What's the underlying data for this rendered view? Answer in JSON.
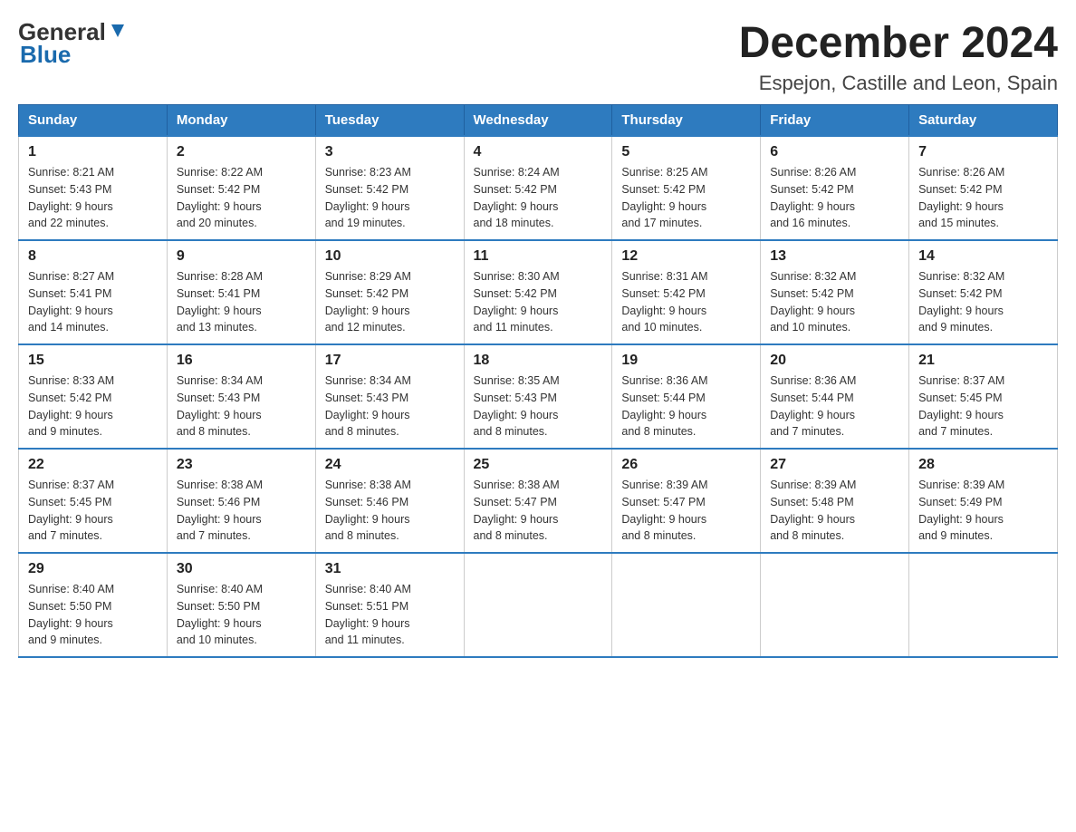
{
  "logo": {
    "general": "General",
    "blue": "Blue"
  },
  "title": "December 2024",
  "subtitle": "Espejon, Castille and Leon, Spain",
  "headers": [
    "Sunday",
    "Monday",
    "Tuesday",
    "Wednesday",
    "Thursday",
    "Friday",
    "Saturday"
  ],
  "weeks": [
    [
      {
        "day": "1",
        "sunrise": "8:21 AM",
        "sunset": "5:43 PM",
        "daylight": "9 hours and 22 minutes."
      },
      {
        "day": "2",
        "sunrise": "8:22 AM",
        "sunset": "5:42 PM",
        "daylight": "9 hours and 20 minutes."
      },
      {
        "day": "3",
        "sunrise": "8:23 AM",
        "sunset": "5:42 PM",
        "daylight": "9 hours and 19 minutes."
      },
      {
        "day": "4",
        "sunrise": "8:24 AM",
        "sunset": "5:42 PM",
        "daylight": "9 hours and 18 minutes."
      },
      {
        "day": "5",
        "sunrise": "8:25 AM",
        "sunset": "5:42 PM",
        "daylight": "9 hours and 17 minutes."
      },
      {
        "day": "6",
        "sunrise": "8:26 AM",
        "sunset": "5:42 PM",
        "daylight": "9 hours and 16 minutes."
      },
      {
        "day": "7",
        "sunrise": "8:26 AM",
        "sunset": "5:42 PM",
        "daylight": "9 hours and 15 minutes."
      }
    ],
    [
      {
        "day": "8",
        "sunrise": "8:27 AM",
        "sunset": "5:41 PM",
        "daylight": "9 hours and 14 minutes."
      },
      {
        "day": "9",
        "sunrise": "8:28 AM",
        "sunset": "5:41 PM",
        "daylight": "9 hours and 13 minutes."
      },
      {
        "day": "10",
        "sunrise": "8:29 AM",
        "sunset": "5:42 PM",
        "daylight": "9 hours and 12 minutes."
      },
      {
        "day": "11",
        "sunrise": "8:30 AM",
        "sunset": "5:42 PM",
        "daylight": "9 hours and 11 minutes."
      },
      {
        "day": "12",
        "sunrise": "8:31 AM",
        "sunset": "5:42 PM",
        "daylight": "9 hours and 10 minutes."
      },
      {
        "day": "13",
        "sunrise": "8:32 AM",
        "sunset": "5:42 PM",
        "daylight": "9 hours and 10 minutes."
      },
      {
        "day": "14",
        "sunrise": "8:32 AM",
        "sunset": "5:42 PM",
        "daylight": "9 hours and 9 minutes."
      }
    ],
    [
      {
        "day": "15",
        "sunrise": "8:33 AM",
        "sunset": "5:42 PM",
        "daylight": "9 hours and 9 minutes."
      },
      {
        "day": "16",
        "sunrise": "8:34 AM",
        "sunset": "5:43 PM",
        "daylight": "9 hours and 8 minutes."
      },
      {
        "day": "17",
        "sunrise": "8:34 AM",
        "sunset": "5:43 PM",
        "daylight": "9 hours and 8 minutes."
      },
      {
        "day": "18",
        "sunrise": "8:35 AM",
        "sunset": "5:43 PM",
        "daylight": "9 hours and 8 minutes."
      },
      {
        "day": "19",
        "sunrise": "8:36 AM",
        "sunset": "5:44 PM",
        "daylight": "9 hours and 8 minutes."
      },
      {
        "day": "20",
        "sunrise": "8:36 AM",
        "sunset": "5:44 PM",
        "daylight": "9 hours and 7 minutes."
      },
      {
        "day": "21",
        "sunrise": "8:37 AM",
        "sunset": "5:45 PM",
        "daylight": "9 hours and 7 minutes."
      }
    ],
    [
      {
        "day": "22",
        "sunrise": "8:37 AM",
        "sunset": "5:45 PM",
        "daylight": "9 hours and 7 minutes."
      },
      {
        "day": "23",
        "sunrise": "8:38 AM",
        "sunset": "5:46 PM",
        "daylight": "9 hours and 7 minutes."
      },
      {
        "day": "24",
        "sunrise": "8:38 AM",
        "sunset": "5:46 PM",
        "daylight": "9 hours and 8 minutes."
      },
      {
        "day": "25",
        "sunrise": "8:38 AM",
        "sunset": "5:47 PM",
        "daylight": "9 hours and 8 minutes."
      },
      {
        "day": "26",
        "sunrise": "8:39 AM",
        "sunset": "5:47 PM",
        "daylight": "9 hours and 8 minutes."
      },
      {
        "day": "27",
        "sunrise": "8:39 AM",
        "sunset": "5:48 PM",
        "daylight": "9 hours and 8 minutes."
      },
      {
        "day": "28",
        "sunrise": "8:39 AM",
        "sunset": "5:49 PM",
        "daylight": "9 hours and 9 minutes."
      }
    ],
    [
      {
        "day": "29",
        "sunrise": "8:40 AM",
        "sunset": "5:50 PM",
        "daylight": "9 hours and 9 minutes."
      },
      {
        "day": "30",
        "sunrise": "8:40 AM",
        "sunset": "5:50 PM",
        "daylight": "9 hours and 10 minutes."
      },
      {
        "day": "31",
        "sunrise": "8:40 AM",
        "sunset": "5:51 PM",
        "daylight": "9 hours and 11 minutes."
      },
      null,
      null,
      null,
      null
    ]
  ],
  "labels": {
    "sunrise": "Sunrise:",
    "sunset": "Sunset:",
    "daylight": "Daylight:"
  }
}
